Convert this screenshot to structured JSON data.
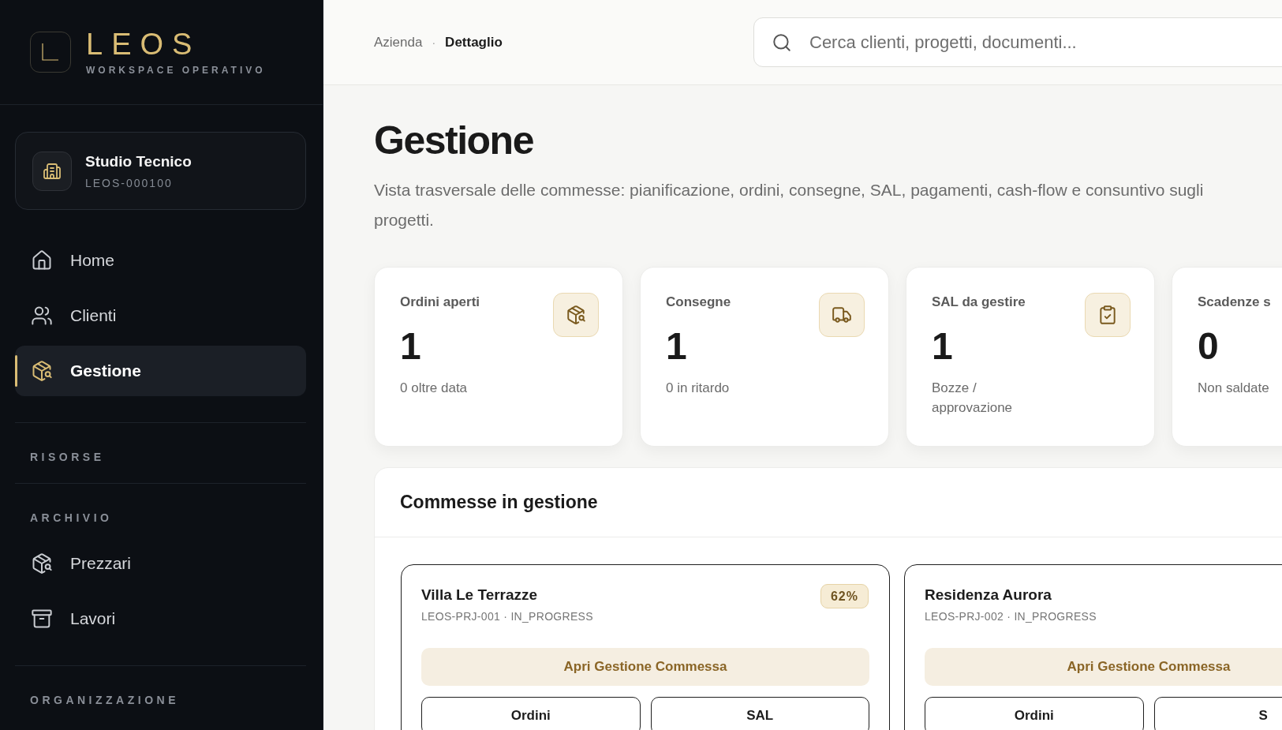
{
  "sidebar": {
    "brand": {
      "name": "LEOS",
      "tagline": "WORKSPACE OPERATIVO"
    },
    "workspace": {
      "name": "Studio Tecnico",
      "code": "LEOS-000100"
    },
    "nav": [
      {
        "label": "Home",
        "selected": false
      },
      {
        "label": "Clienti",
        "selected": false
      },
      {
        "label": "Gestione",
        "selected": true
      }
    ],
    "sections": [
      {
        "title": "RISORSE"
      },
      {
        "title": "ARCHIVIO",
        "items": [
          {
            "label": "Prezzari",
            "selected": false
          },
          {
            "label": "Lavori",
            "selected": false
          }
        ]
      },
      {
        "title": "ORGANIZZAZIONE"
      }
    ]
  },
  "header": {
    "breadcrumb": [
      "Azienda",
      "Dettaglio"
    ],
    "breadcrumb_separator": "·",
    "search": {
      "placeholder": "Cerca clienti, progetti, documenti..."
    }
  },
  "page": {
    "title": "Gestione",
    "description": "Vista trasversale delle commesse: pianificazione, ordini, consegne, SAL, pagamenti, cash-flow e consuntivo sugli progetti."
  },
  "stats": [
    {
      "label": "Ordini aperti",
      "value": "1",
      "note": "0 oltre data"
    },
    {
      "label": "Consegne",
      "value": "1",
      "note": "0 in ritardo"
    },
    {
      "label": "SAL da gestire",
      "value": "1",
      "note": "Bozze / approvazione"
    },
    {
      "label": "Scadenze s",
      "value": "0",
      "note": "Non saldate"
    }
  ],
  "commesse": {
    "title": "Commesse in gestione",
    "projects": [
      {
        "name": "Villa Le Terrazze",
        "code": "LEOS-PRJ-001 · IN_PROGRESS",
        "progress": "62%",
        "primary": "Apri Gestione Commessa",
        "buttons": [
          "Ordini",
          "SAL"
        ]
      },
      {
        "name": "Residenza Aurora",
        "code": "LEOS-PRJ-002 · IN_PROGRESS",
        "primary": "Apri Gestione Commessa",
        "buttons": [
          "Ordini",
          "S"
        ]
      }
    ]
  }
}
